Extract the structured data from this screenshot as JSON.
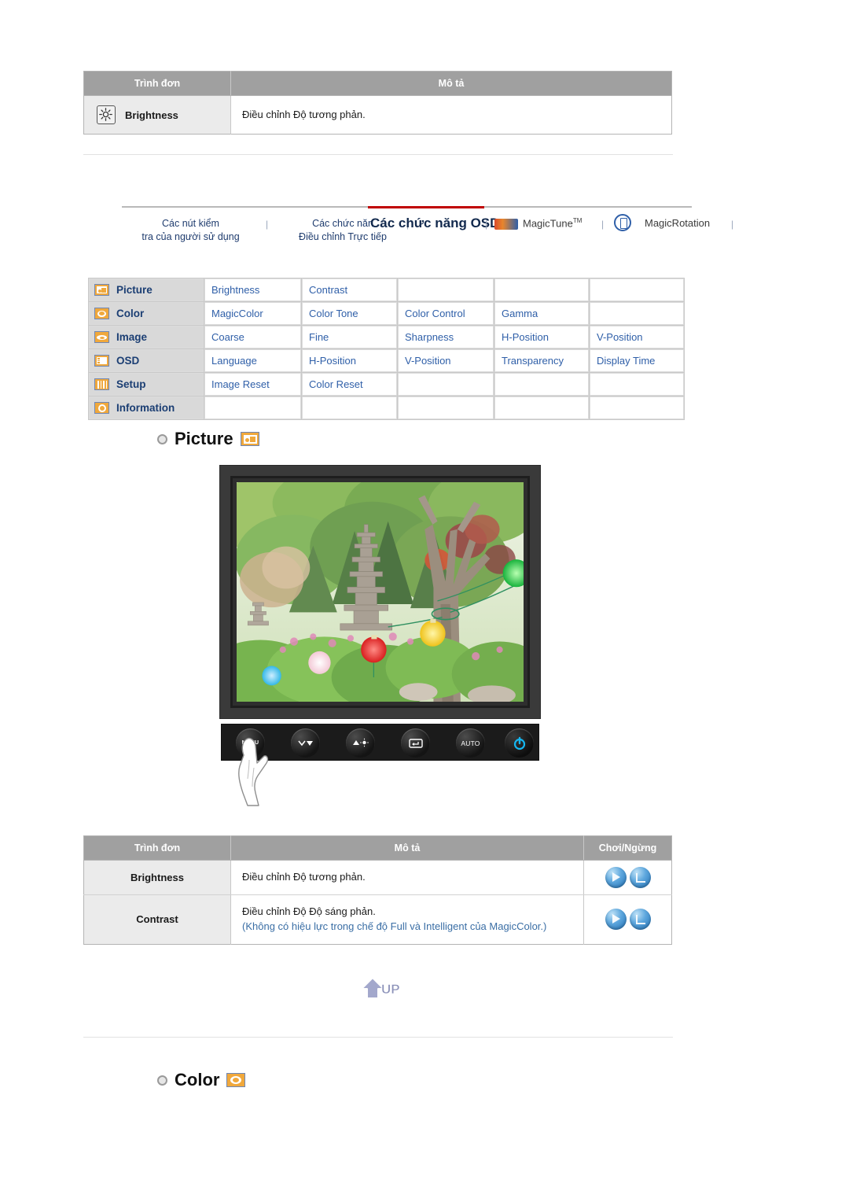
{
  "top_table": {
    "headers": [
      "Trình đơn",
      "Mô tả"
    ],
    "rows": [
      {
        "menu": "Brightness",
        "icon": "brightness-icon",
        "desc": "Điều chỉnh Độ tương phản."
      }
    ]
  },
  "navbar": {
    "items": [
      {
        "label": "Các nút kiểm\ntra của người sử dụng",
        "active": false,
        "style": "link"
      },
      {
        "label": "Các chức năn\nĐiều chỉnh Trực tiếp",
        "active": false,
        "style": "link"
      },
      {
        "label": "Các chức năng OSD",
        "active": true,
        "style": "heading"
      },
      {
        "label": "MagicTune",
        "sup": "TM",
        "active": false,
        "style": "plain",
        "icon": "magictune-logo"
      },
      {
        "label": "MagicRotation",
        "active": false,
        "style": "plain",
        "icon": "magicrotation-logo"
      }
    ],
    "separator": "|",
    "accent_color": "#c00000"
  },
  "osd_grid": {
    "rows": [
      {
        "icon": "picture-icon",
        "category": "Picture",
        "items": [
          "Brightness",
          "Contrast",
          "",
          "",
          ""
        ]
      },
      {
        "icon": "color-icon",
        "category": "Color",
        "items": [
          "MagicColor",
          "Color Tone",
          "Color Control",
          "Gamma",
          ""
        ]
      },
      {
        "icon": "image-icon",
        "category": "Image",
        "items": [
          "Coarse",
          "Fine",
          "Sharpness",
          "H-Position",
          "V-Position"
        ]
      },
      {
        "icon": "osd-icon",
        "category": "OSD",
        "items": [
          "Language",
          "H-Position",
          "V-Position",
          "Transparency",
          "Display Time"
        ]
      },
      {
        "icon": "setup-icon",
        "category": "Setup",
        "items": [
          "Image Reset",
          "Color Reset",
          "",
          "",
          ""
        ]
      },
      {
        "icon": "information-icon",
        "category": "Information",
        "items": [
          "",
          "",
          "",
          "",
          ""
        ]
      }
    ],
    "link_color": "#2f5fa8",
    "category_color": "#1b3e73",
    "icon_color": "#f0a83c"
  },
  "sections": [
    {
      "title": "Picture",
      "icon": "picture-icon"
    },
    {
      "title": "Color",
      "icon": "color-icon"
    }
  ],
  "monitor": {
    "buttons": [
      {
        "name": "menu-button",
        "label": "MENU"
      },
      {
        "name": "down-button",
        "label": ""
      },
      {
        "name": "up-brightness-button",
        "label": ""
      },
      {
        "name": "enter-button",
        "label": ""
      },
      {
        "name": "auto-button",
        "label": "AUTO"
      },
      {
        "name": "power-button",
        "label": ""
      }
    ],
    "power_led_color": "#15b6f0"
  },
  "bottom_table": {
    "headers": [
      "Trình đơn",
      "Mô tả",
      "Chơi/Ngừng"
    ],
    "rows": [
      {
        "menu": "Brightness",
        "desc_main": "Điều chỉnh Độ tương phản.",
        "desc_note": "",
        "controls": [
          "play",
          "stop"
        ]
      },
      {
        "menu": "Contrast",
        "desc_main": "Điều chỉnh Độ Độ sáng phản.",
        "desc_note": "(Không có hiệu lực trong chế độ Full và Intelligent của MagicColor.)",
        "controls": [
          "play",
          "stop"
        ]
      }
    ],
    "note_color": "#3a6ea5"
  },
  "up_button": {
    "label": "UP"
  }
}
